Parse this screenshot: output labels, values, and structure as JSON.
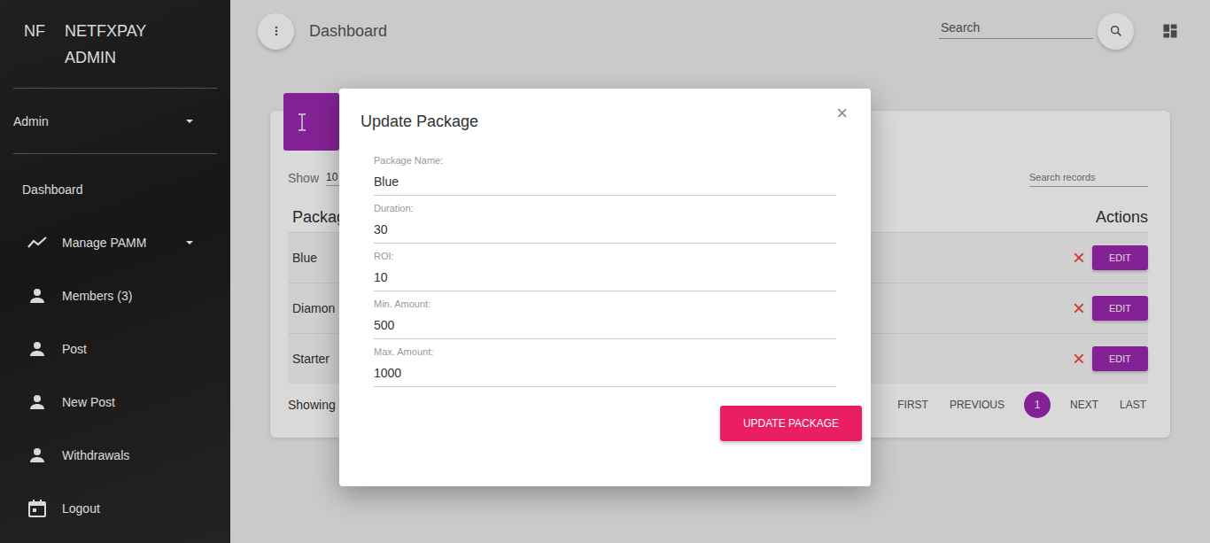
{
  "sidebar": {
    "logo_short": "NF",
    "logo": "NETFXPAY ADMIN",
    "user": "Admin",
    "items": [
      {
        "label": "Dashboard",
        "kind": "plain",
        "submenu": false
      },
      {
        "label": "Manage PAMM",
        "kind": "trend",
        "submenu": true
      },
      {
        "label": "Members (3)",
        "kind": "person",
        "submenu": false
      },
      {
        "label": "Post",
        "kind": "person",
        "submenu": false
      },
      {
        "label": "New Post",
        "kind": "person",
        "submenu": false
      },
      {
        "label": "Withdrawals",
        "kind": "person",
        "submenu": false
      },
      {
        "label": "Logout",
        "kind": "calendar",
        "submenu": false
      }
    ]
  },
  "navbar": {
    "title": "Dashboard",
    "search_placeholder": "Search"
  },
  "card": {
    "show_label": "Show",
    "page_size": "10",
    "search_placeholder": "Search records",
    "columns": [
      "Packag",
      "Actions"
    ],
    "rows": [
      {
        "name": "Blue",
        "delete": "×",
        "edit": "EDIT"
      },
      {
        "name": "Diamon",
        "delete": "×",
        "edit": "EDIT"
      },
      {
        "name": "Starter",
        "delete": "×",
        "edit": "EDIT"
      }
    ],
    "footer": "Showing",
    "pagination": [
      {
        "label": "FIRST",
        "selected": false
      },
      {
        "label": "PREVIOUS",
        "selected": false
      },
      {
        "label": "1",
        "selected": true
      },
      {
        "label": "NEXT",
        "selected": false
      },
      {
        "label": "LAST",
        "selected": false
      }
    ]
  },
  "modal": {
    "title": "Update Package",
    "close": "×",
    "fields": [
      {
        "label": "Package Name:",
        "value": "Blue"
      },
      {
        "label": "Duration:",
        "value": "30"
      },
      {
        "label": "ROI:",
        "value": "10"
      },
      {
        "label": "Min. Amount:",
        "value": "500"
      },
      {
        "label": "Max. Amount:",
        "value": "1000"
      }
    ],
    "button": "UPDATE PACKAGE"
  }
}
